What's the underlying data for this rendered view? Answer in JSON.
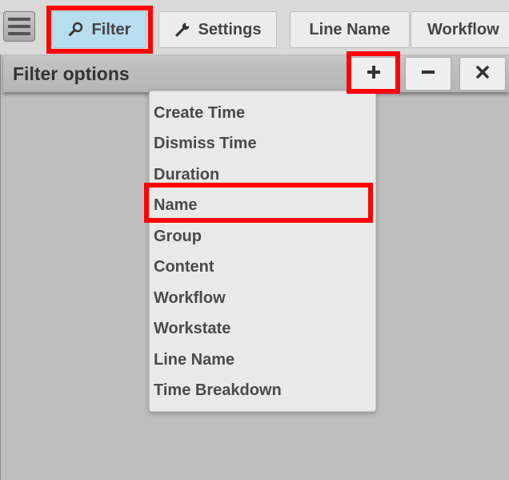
{
  "toolbar": {
    "menu_icon": "hamburger-menu-icon",
    "filter_label": "Filter",
    "filter_icon": "search-icon",
    "settings_label": "Settings",
    "settings_icon": "wrench-icon",
    "line_name_label": "Line Name",
    "workflow_label": "Workflow"
  },
  "filter_options": {
    "title": "Filter options",
    "add_icon": "plus-icon",
    "remove_icon": "minus-icon",
    "close_icon": "close-x-icon"
  },
  "dropdown": {
    "items": [
      "Create Time",
      "Dismiss Time",
      "Duration",
      "Name",
      "Group",
      "Content",
      "Workflow",
      "Workstate",
      "Line Name",
      "Time Breakdown"
    ]
  },
  "colors": {
    "active_tab": "#b7ddef",
    "highlight": "#ff0000",
    "panel_bg": "#e9e9e9",
    "background": "#bdbdbd"
  }
}
